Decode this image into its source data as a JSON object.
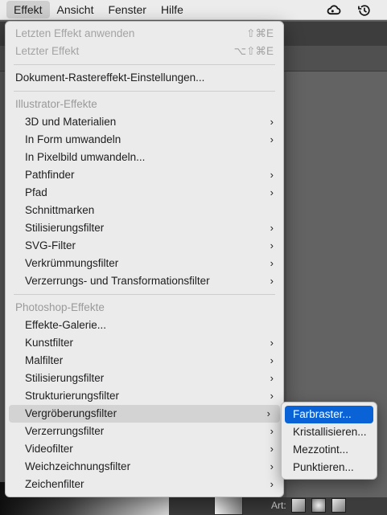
{
  "menubar": {
    "items": [
      "Effekt",
      "Ansicht",
      "Fenster",
      "Hilfe"
    ],
    "active_index": 0,
    "tray_icons": [
      "creative-cloud-icon",
      "time-machine-icon"
    ]
  },
  "menu": {
    "apply_last": {
      "label": "Letzten Effekt anwenden",
      "shortcut": "⇧⌘E"
    },
    "last_effect": {
      "label": "Letzter Effekt",
      "shortcut": "⌥⇧⌘E"
    },
    "document_raster": {
      "label": "Dokument-Rastereffekt-Einstellungen..."
    },
    "illustrator_header": "Illustrator-Effekte",
    "illustrator_items": [
      {
        "label": "3D und Materialien",
        "submenu": true
      },
      {
        "label": "In Form umwandeln",
        "submenu": true
      },
      {
        "label": "In Pixelbild umwandeln...",
        "submenu": false
      },
      {
        "label": "Pathfinder",
        "submenu": true
      },
      {
        "label": "Pfad",
        "submenu": true
      },
      {
        "label": "Schnittmarken",
        "submenu": false
      },
      {
        "label": "Stilisierungsfilter",
        "submenu": true
      },
      {
        "label": "SVG-Filter",
        "submenu": true
      },
      {
        "label": "Verkrümmungsfilter",
        "submenu": true
      },
      {
        "label": "Verzerrungs- und Transformationsfilter",
        "submenu": true
      }
    ],
    "photoshop_header": "Photoshop-Effekte",
    "photoshop_items": [
      {
        "label": "Effekte-Galerie...",
        "submenu": false
      },
      {
        "label": "Kunstfilter",
        "submenu": true
      },
      {
        "label": "Malfilter",
        "submenu": true
      },
      {
        "label": "Stilisierungsfilter",
        "submenu": true
      },
      {
        "label": "Strukturierungsfilter",
        "submenu": true
      },
      {
        "label": "Vergröberungsfilter",
        "submenu": true
      },
      {
        "label": "Verzerrungsfilter",
        "submenu": true
      },
      {
        "label": "Videofilter",
        "submenu": true
      },
      {
        "label": "Weichzeichnungsfilter",
        "submenu": true
      },
      {
        "label": "Zeichenfilter",
        "submenu": true
      }
    ],
    "highlighted_photoshop_index": 5,
    "chevron_glyph": "›"
  },
  "submenu": {
    "items": [
      "Farbraster...",
      "Kristallisieren...",
      "Mezzotint...",
      "Punktieren..."
    ],
    "selected_index": 0
  },
  "background": {
    "art_label": "Art:"
  },
  "colors": {
    "selection_blue": "#0a63d6",
    "menu_bg": "#ebebeb",
    "hover_gray": "#d3d3d3"
  }
}
